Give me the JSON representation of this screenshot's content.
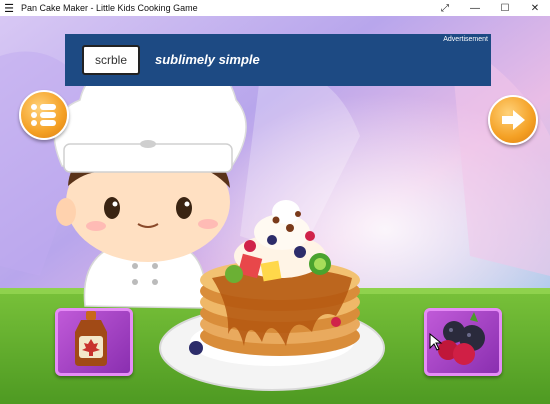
{
  "window": {
    "title": "Pan Cake Maker - Little Kids Cooking Game",
    "menu_icon": "hamburger-menu-icon",
    "controls": [
      "fullscreen-icon",
      "minimize-icon",
      "maximize-icon",
      "close-icon"
    ]
  },
  "ad": {
    "tag": "Advertisement",
    "logo_text": "scrble",
    "slogan": "sublimely simple"
  },
  "game": {
    "menu_button_icon": "list-icon",
    "next_button_icon": "arrow-right-icon",
    "items": [
      {
        "name": "maple-syrup",
        "icon": "maple-leaf-icon"
      },
      {
        "name": "berries",
        "icon": "berries-icon"
      }
    ]
  },
  "colors": {
    "table": "#6fb52f",
    "ad_bg": "#1d4a83",
    "button_orange": "#f4a024",
    "tile_purple": "#a23ed0",
    "pancake": "#e3a457",
    "syrup": "#b3560f"
  }
}
